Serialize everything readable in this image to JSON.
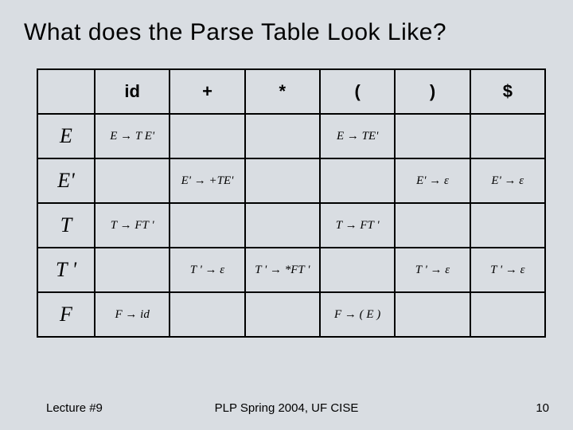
{
  "chart_data": {
    "type": "table",
    "title": "What does the Parse Table Look Like?",
    "columns": [
      "id",
      "+",
      "*",
      "(",
      ")",
      "$"
    ],
    "rows": [
      "E",
      "E'",
      "T",
      "T '",
      "F"
    ],
    "cells": {
      "E": {
        "id": "E → T E'",
        "(": "E → TE'"
      },
      "Eprime": {
        "+": "E' → +TE'",
        ")": "E' → ε",
        "$": "E' → ε"
      },
      "T": {
        "id": "T → FT '",
        "(": "T → FT '"
      },
      "Tprime": {
        "+": "T ' → ε",
        "*": "T ' → *FT '",
        ")": "T ' → ε",
        "$": "T ' → ε"
      },
      "F": {
        "id": "F → id",
        "(": "F → ( E )"
      }
    }
  },
  "title": "What does the Parse Table Look Like?",
  "headers": {
    "col1": "id",
    "col2": "+",
    "col3": "*",
    "col4": "(",
    "col5": ")",
    "col6": "$",
    "rowE": "E",
    "rowEp": "E'",
    "rowT": "T",
    "rowTp": "T '",
    "rowF": "F"
  },
  "cells": {
    "E_id": "E → T E'",
    "E_lp": "E → TE'",
    "Ep_plus": "E' → +TE'",
    "Ep_rp": "E' → ε",
    "Ep_dol": "E' → ε",
    "T_id": "T → FT '",
    "T_lp": "T → FT '",
    "Tp_plus": "T ' → ε",
    "Tp_star": "T ' → *FT '",
    "Tp_rp": "T ' → ε",
    "Tp_dol": "T ' → ε",
    "F_id": "F → id",
    "F_lp": "F → ( E )"
  },
  "footer": {
    "left": "Lecture #9",
    "center": "PLP Spring 2004, UF CISE",
    "right": "10"
  }
}
